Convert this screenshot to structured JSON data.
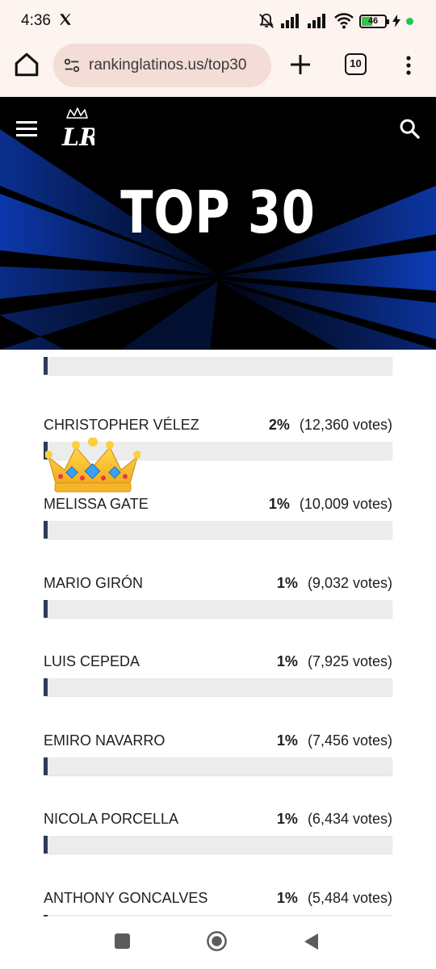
{
  "status": {
    "time": "4:36",
    "battery": "46"
  },
  "browser": {
    "url": "rankinglatinos.us/top30",
    "tab_count": "10"
  },
  "hero": {
    "title": "TOP 30",
    "logo_text": "LR"
  },
  "votes": [
    {
      "name": "",
      "pct": "",
      "votes": "",
      "fill": 0.015
    },
    {
      "name": "CHRISTOPHER VÉLEZ",
      "pct": "2%",
      "votes": "(12,360 votes)",
      "fill": 0.02
    },
    {
      "name": "MELISSA GATE",
      "pct": "1%",
      "votes": "(10,009 votes)",
      "fill": 0.01
    },
    {
      "name": "MARIO GIRÓN",
      "pct": "1%",
      "votes": "(9,032 votes)",
      "fill": 0.01
    },
    {
      "name": "LUIS CEPEDA",
      "pct": "1%",
      "votes": "(7,925 votes)",
      "fill": 0.01
    },
    {
      "name": "EMIRO NAVARRO",
      "pct": "1%",
      "votes": "(7,456 votes)",
      "fill": 0.01
    },
    {
      "name": "NICOLA PORCELLA",
      "pct": "1%",
      "votes": "(6,434 votes)",
      "fill": 0.01
    },
    {
      "name": "ANTHONY GONCALVES",
      "pct": "1%",
      "votes": "(5,484 votes)",
      "fill": 0.01
    }
  ],
  "colors": {
    "accent_blue": "#0a3fc4",
    "bar_fill": "#2f3b57",
    "bar_track": "#ececec",
    "browser_bg": "#fdf3ef"
  },
  "icons": [
    "x-logo-icon",
    "mute-bell-icon",
    "signal-icon",
    "wifi-icon",
    "battery-icon",
    "charging-icon",
    "home-icon",
    "site-settings-icon",
    "plus-icon",
    "tabs-icon",
    "more-vert-icon",
    "hamburger-icon",
    "search-icon",
    "crown-icon"
  ]
}
